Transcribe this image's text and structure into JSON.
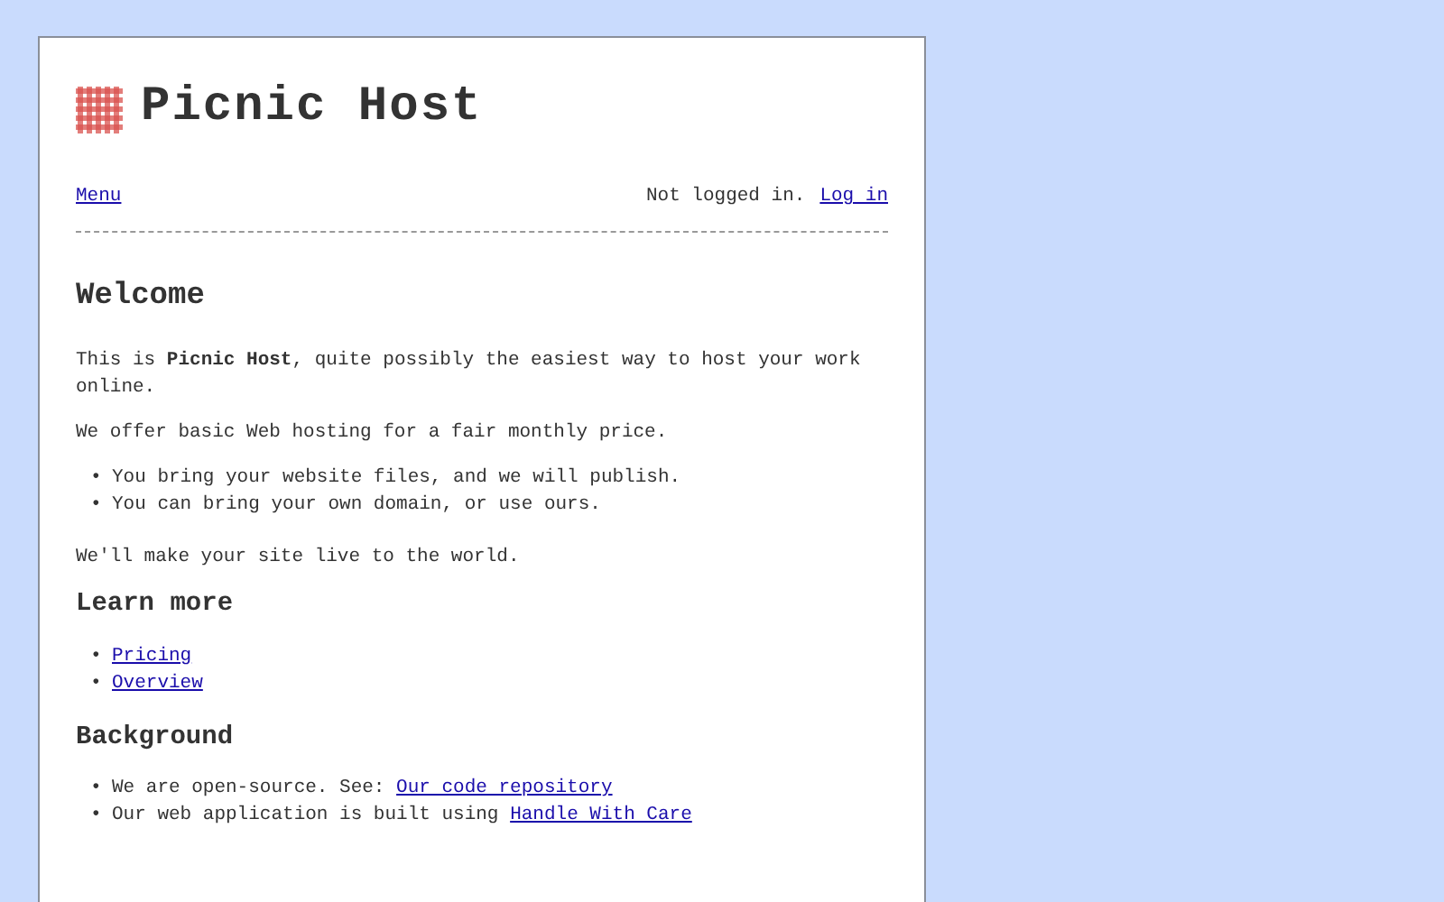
{
  "site": {
    "title": "Picnic Host"
  },
  "nav": {
    "menu_link": "Menu",
    "status": "Not logged in.",
    "login_link": "Log in"
  },
  "sections": [
    {
      "heading": "Welcome",
      "paragraphs_before": [
        "This is **Picnic Host**, quite possibly the easiest way to host your work online.",
        "We offer basic Web hosting for a fair monthly price."
      ],
      "items": [
        {
          "bullet": "•",
          "text": "You bring your website files, and we will publish."
        },
        {
          "bullet": "•",
          "text": "You can bring your own domain, or use ours."
        }
      ],
      "paragraphs_after": [
        "We'll make your site live to the world."
      ]
    },
    {
      "heading": "Learn more",
      "items": [
        {
          "bullet": "•",
          "link": "Pricing"
        },
        {
          "bullet": "•",
          "link": "Overview"
        }
      ]
    },
    {
      "heading": "Background",
      "items": [
        {
          "bullet": "•",
          "text": "We are open-source. See:",
          "link": "Our code repository"
        },
        {
          "bullet": "•",
          "text": "Our web application is built using",
          "link": "Handle With Care"
        }
      ]
    }
  ]
}
